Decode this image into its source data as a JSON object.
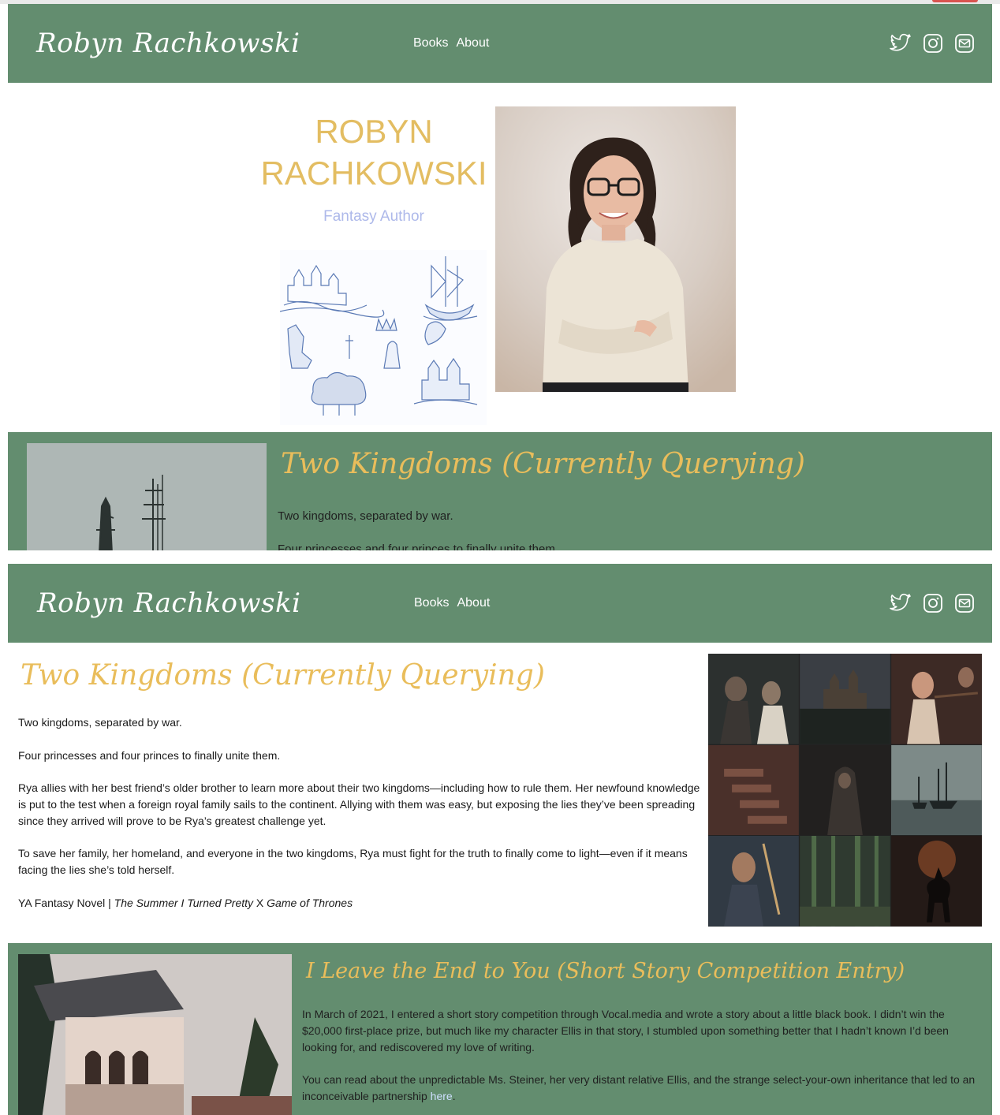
{
  "brand": "Robyn Rachkowski",
  "nav": {
    "books": "Books",
    "about": "About"
  },
  "icons": [
    "twitter-icon",
    "instagram-icon",
    "mail-icon"
  ],
  "hero": {
    "name_line1": "ROBYN",
    "name_line2": "RACHKOWSKI",
    "subtitle": "Fantasy Author"
  },
  "book1": {
    "title": "Two Kingdoms (Currently Querying)",
    "paragraphs": [
      "Two kingdoms, separated by war.",
      "Four princesses and four princes to finally unite them.",
      "Rya allies with her best friend’s older brother to learn more about their two kingdoms—including how to rule them. Her newfound knowledge is put to the test when a foreign royal family sails to the continent. Allying with them was easy, but exposing the lies they’ve been spreading since they arrived will prove to be Rya’s greatest challenge yet.",
      "To save her family, her homeland, and everyone in the two kingdoms, Rya must fight for the truth to finally come to light—even if it means facing the lies she’s told herself."
    ],
    "genre_prefix": "YA Fantasy Novel | ",
    "comp1": "The Summer I Turned Pretty",
    "comp_sep": " X ",
    "comp2": "Game of Thrones"
  },
  "book2": {
    "title": "I Leave the End to You (Short Story Competition Entry)",
    "paragraph1": "In March of 2021, I entered a short story competition through Vocal.media and wrote a story about a little black book. I didn’t win the $20,000 first-place prize, but much like my character Ellis in that story, I stumbled upon something better that I hadn’t known I’d been looking for, and rediscovered my love of writing.",
    "paragraph2": "You can read about the unpredictable Ms. Steiner, her very distant relative Ellis, and the strange select-your-own inheritance that led to an inconceivable partnership ",
    "link": "here",
    "end": "."
  },
  "colors": {
    "green": "#638d6f",
    "gold": "#e3bd62",
    "lavender": "#aeb9ea"
  }
}
